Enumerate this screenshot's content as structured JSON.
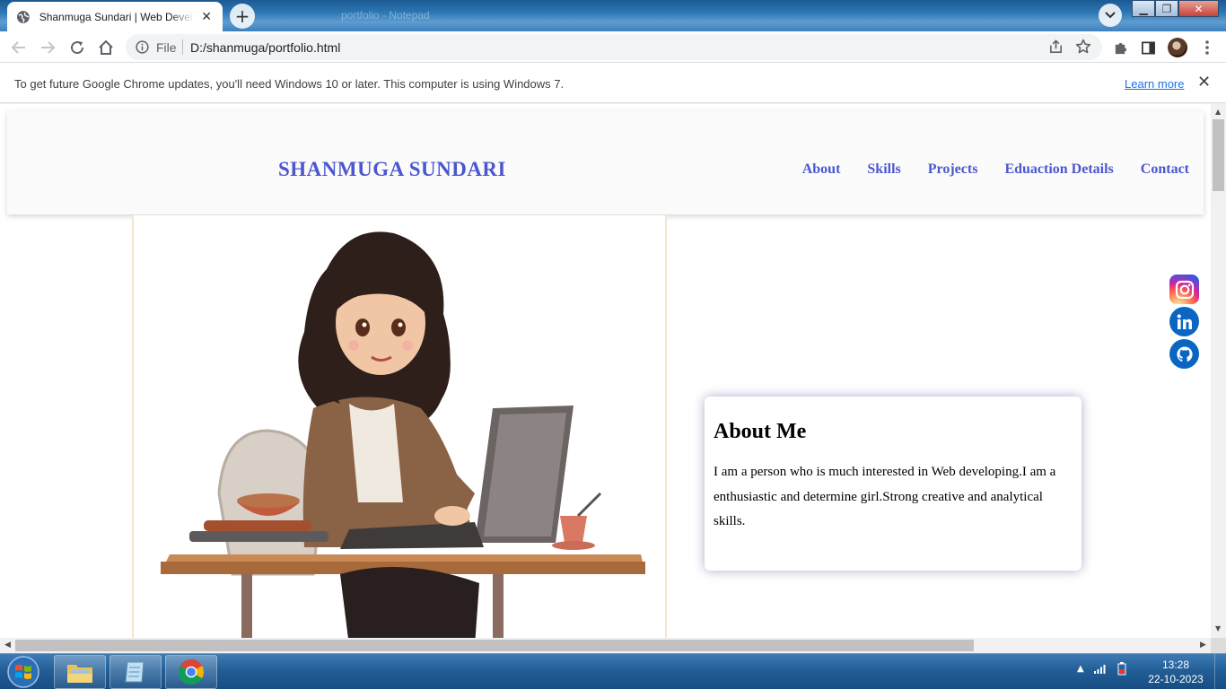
{
  "browser": {
    "tab_title": "Shanmuga Sundari | Web Developer",
    "background_window_title": "portfolio - Notepad",
    "omnibox": {
      "scheme_label": "File",
      "url": "D:/shanmuga/portfolio.html"
    },
    "infobar": {
      "message": "To get future Google Chrome updates, you'll need Windows 10 or later. This computer is using Windows 7.",
      "link": "Learn more"
    }
  },
  "site": {
    "brand": "SHANMUGA SUNDARI",
    "nav": [
      "About",
      "Skills",
      "Projects",
      "Eduaction Details",
      "Contact"
    ],
    "about": {
      "heading": "About Me",
      "text": "I am a person who is much interested in Web developing.I am a enthusiastic and determine girl.Strong creative and analytical skills."
    },
    "social_icons": [
      "instagram-icon",
      "linkedin-icon",
      "github-icon"
    ]
  },
  "taskbar": {
    "pinned": [
      "file-explorer-icon",
      "notepad-icon",
      "chrome-icon"
    ],
    "time": "13:28",
    "date": "22-10-2023"
  },
  "colors": {
    "brand": "#4b57cf",
    "link": "#1a73e8"
  }
}
